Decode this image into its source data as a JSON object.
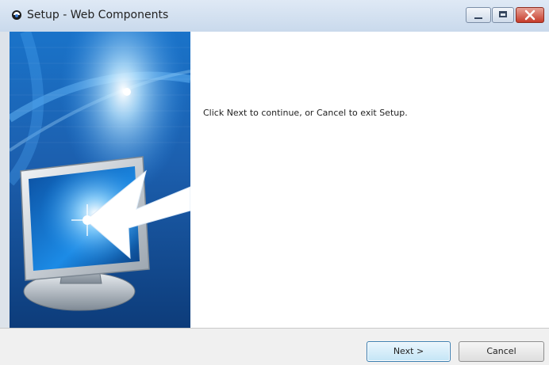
{
  "window": {
    "title": "Setup - Web Components"
  },
  "content": {
    "message": "Click Next to continue, or Cancel to exit Setup."
  },
  "buttons": {
    "next": "Next >",
    "cancel": "Cancel"
  },
  "icons": {
    "app": "setup-app-icon",
    "minimize": "minimize-icon",
    "maximize": "maximize-icon",
    "close": "close-icon",
    "banner": "monitor-arrow-illustration"
  },
  "colors": {
    "banner_primary": "#1f5aa8",
    "banner_highlight": "#7fd0ff",
    "close_button": "#c63b2a"
  }
}
